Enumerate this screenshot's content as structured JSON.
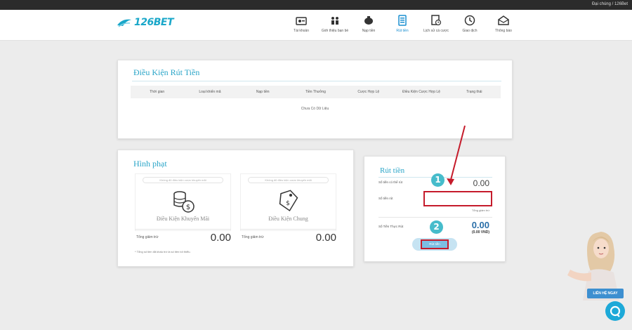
{
  "topbar": {
    "account_text": "Đại chúng / 126Bet"
  },
  "brand": {
    "logo_text": "126BET",
    "accent": "#1aa7c9"
  },
  "nav": [
    {
      "label": "Tài khoản",
      "icon": "account-icon"
    },
    {
      "label": "Giới thiệu bạn bè",
      "icon": "referral-icon"
    },
    {
      "label": "Nạp tiền",
      "icon": "deposit-icon"
    },
    {
      "label": "Rút tiền",
      "icon": "withdraw-icon",
      "active": true
    },
    {
      "label": "Lịch sử cá cược",
      "icon": "history-icon"
    },
    {
      "label": "Giao dịch",
      "icon": "transaction-icon"
    },
    {
      "label": "Thông báo",
      "icon": "mail-icon"
    }
  ],
  "conditions": {
    "title": "Điều Kiện Rút Tiền",
    "columns": [
      "Thời gian",
      "Loại khiến mã",
      "Nạp tiền",
      "Tiền Thưởng",
      "Cược Hợp Lệ",
      "Điều Kiện Cược Hợp Lệ",
      "Trạng thái"
    ],
    "empty_text": "Chưa Có Dữ Liệu"
  },
  "penalty": {
    "title": "Hình phạt",
    "promo": {
      "pill_text": "Không đủ điều kiện cược khuyến mãi",
      "label": "Điều Kiện Khuyến Mãi",
      "total_label": "Tổng giảm trừ",
      "value": "0.00"
    },
    "general": {
      "pill_text": "Không đủ điều kiện cược khuyến mãi",
      "label": "Điều Kiện Chung",
      "total_label": "Tổng giảm trừ",
      "value": "0.00"
    },
    "note": "* Tổng số tiền đã khấu trừ là số tiền tối thiểu."
  },
  "withdraw": {
    "title": "Rút tiền",
    "balance_label": "Số tiền có thể rút",
    "balance_value": "0.00",
    "amount_label": "Số tiền rút",
    "amount_value": "",
    "hint": "Tổng giảm trừ",
    "total_label": "Số Tiền Thực Rút",
    "total_value": "0.00",
    "total_vnd": "(0.00 VND)",
    "button_label": "Rút tiền",
    "step1": "1",
    "step2": "2"
  },
  "support": {
    "badge_label": "LIÊN HỆ NGAY"
  }
}
